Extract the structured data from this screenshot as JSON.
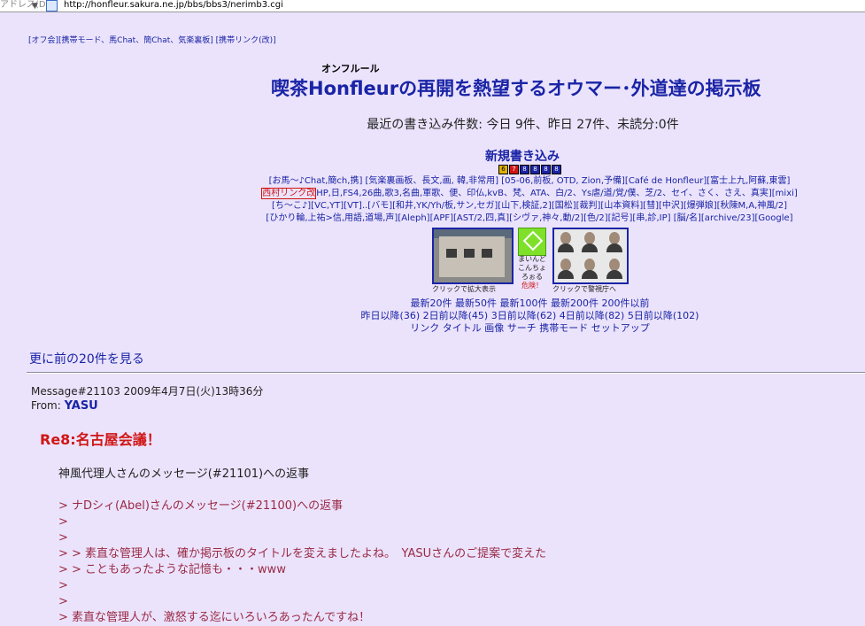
{
  "browser": {
    "address_label": "アドレス(D)",
    "go_button": "▼",
    "url": "http://honfleur.sakura.ne.jp/bbs/bbs3/nerimb3.cgi"
  },
  "top_links": "[オフ会][携帯モード、馬Chat、簡Chat、気楽裏板] [携帯リンク(改)]",
  "title_ruby": "オンフルール",
  "title": "喫茶Honfleurの再開を熱望するオウマー･外道達の掲示板",
  "post_counts": "最近の書き込み件数: 今日 9件、昨日 27件、未読分:0件",
  "new_post_link": "新規書き込み",
  "day_badges": [
    "6",
    "7",
    "8",
    "8",
    "8",
    "8"
  ],
  "link_block": [
    "[お馬〜♪Chat,簡ch,携] [気楽裏画板、長文,画, 韓,非常用] [05-06,前板, OTD, Zion,予備][Café de Honfleur][富士上九,阿蘇,東雲]",
    "[西村リンク改]HP,日,FS4,26曲,歌3,名曲,軍歌、便、印仏,kvB、梵、ATA、白/2、Ys虐/道/覚/僕、芝/2、セイ、さく、さえ、真実][mixi]",
    "[ち〜こ♪][VC,YT][VT]..[バモ][和井,YK/Yh/板,サン,セガ][山下,検証,2][国松][裁判][山本資料][彗][中沢][爆弾娘][秋陳M,A,神風/2]",
    "[ひかり輪,上祐>信,用語,道場,声][Aleph][APF][AST/2,四,真][シヴァ,神々,動/2][色/2][記号][串,診,IP] [脳/名][archive/23][Google]"
  ],
  "photo1_caption": "クリックで拡大表示",
  "badge_caption": [
    "まいんど",
    "こんちょ",
    "ろぉる",
    "危険！"
  ],
  "photo2_caption": "クリックで警視庁へ",
  "nav_line1": "最新20件 最新50件 最新100件 最新200件 200件以前",
  "nav_line2": "昨日以降(36) 2日前以降(45) 3日前以降(62) 4日前以降(82) 5日前以降(102)",
  "nav_line3": "リンク タイトル 画像 サーチ 携帯モード セットアップ",
  "prev20": "更に前の20件を見る",
  "message": {
    "meta": "Message#21103 2009年4月7日(火)13時36分",
    "from_label": "From: ",
    "from_name": "YASU",
    "subject": "Re8:名古屋会議！",
    "reply_line": "神風代理人さんのメッセージ(#21101)への返事",
    "quotes": [
      "> ナDシィ(Abel)さんのメッセージ(#21100)への返事",
      ">",
      ">",
      "> > 素直な管理人は、確か掲示板のタイトルを変えましたよね。　YASUさんのご提案で変えた",
      "> > こともあったような記憶も・・・www",
      ">",
      ">",
      "> 素直な管理人が、激怒する迄にいろいろあったんですね！"
    ]
  }
}
